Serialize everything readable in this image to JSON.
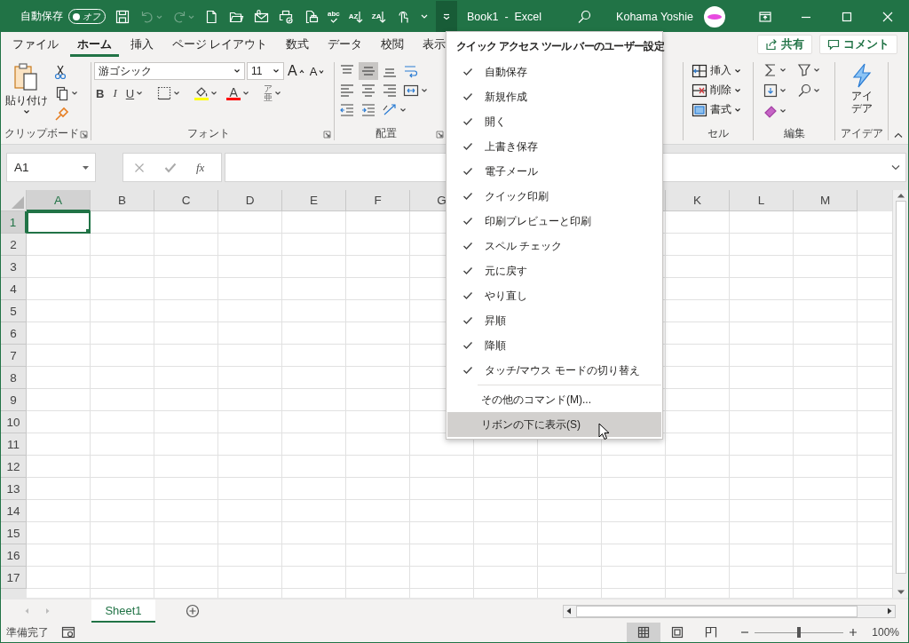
{
  "title_bar": {
    "autosave_label": "自動保存",
    "autosave_toggle": {
      "label": "オフ",
      "on": false
    },
    "qat": [
      {
        "kind": "save",
        "disabled": false
      },
      {
        "kind": "undo",
        "disabled": true
      },
      {
        "kind": "redo",
        "disabled": true
      },
      {
        "kind": "new",
        "disabled": false
      },
      {
        "kind": "open",
        "disabled": false
      },
      {
        "kind": "email",
        "disabled": false
      },
      {
        "kind": "quick_print",
        "disabled": false
      },
      {
        "kind": "print_preview",
        "disabled": false
      },
      {
        "kind": "spelling",
        "label": "abc",
        "disabled": false
      },
      {
        "kind": "sort_asc",
        "label": "AZ",
        "disabled": false
      },
      {
        "kind": "sort_desc",
        "label": "ZA",
        "disabled": false
      },
      {
        "kind": "touch",
        "disabled": false
      }
    ],
    "customize_selected": true,
    "title": "Book1  -  Excel",
    "user": "Kohama Yoshie"
  },
  "tabs": [
    {
      "label": "ファイル",
      "selected": false
    },
    {
      "label": "ホーム",
      "selected": true
    },
    {
      "label": "挿入",
      "selected": false
    },
    {
      "label": "ページ レイアウト",
      "selected": false
    },
    {
      "label": "数式",
      "selected": false
    },
    {
      "label": "データ",
      "selected": false
    },
    {
      "label": "校閲",
      "selected": false
    },
    {
      "label": "表示",
      "selected": false
    }
  ],
  "share": "共有",
  "comment": "コメント",
  "ribbon": {
    "clipboard": {
      "paste": "貼り付け",
      "label": "クリップボード"
    },
    "font": {
      "name": "游ゴシック",
      "size": "11",
      "grow": "A",
      "shrink": "A",
      "bold": "B",
      "italic": "I",
      "underline": "U",
      "font_color": "A",
      "phonetic": "ア亜",
      "label": "フォント"
    },
    "alignment": {
      "label": "配置",
      "buttons": [
        {
          "kind": "top",
          "selected": false
        },
        {
          "kind": "middle",
          "selected": true
        },
        {
          "kind": "bottom",
          "selected": false
        },
        {
          "kind": "wrap",
          "selected": false
        },
        {
          "kind": "left",
          "selected": false
        },
        {
          "kind": "center",
          "selected": false
        },
        {
          "kind": "right",
          "selected": false
        },
        {
          "kind": "merge",
          "selected": false
        },
        {
          "kind": "indent_dec",
          "selected": false
        },
        {
          "kind": "indent_inc",
          "selected": false
        },
        {
          "kind": "orientation",
          "selected": false
        }
      ]
    },
    "cells": {
      "items": [
        {
          "kind": "insert",
          "label": "挿入"
        },
        {
          "kind": "delete",
          "label": "削除"
        },
        {
          "kind": "format",
          "label": "書式"
        }
      ],
      "label": "セル"
    },
    "editing": {
      "label": "編集"
    },
    "ideas": {
      "button": "アイデア",
      "label": "アイデア"
    }
  },
  "formula_bar": {
    "name_box": "A1",
    "fx": "fx"
  },
  "sheet": {
    "columns": [
      {
        "label": "A",
        "selected": true
      },
      {
        "label": "B",
        "selected": false
      },
      {
        "label": "C",
        "selected": false
      },
      {
        "label": "D",
        "selected": false
      },
      {
        "label": "E",
        "selected": false
      },
      {
        "label": "F",
        "selected": false
      },
      {
        "label": "G",
        "selected": false
      },
      {},
      {},
      {},
      {
        "label": "K",
        "selected": false
      },
      {
        "label": "L",
        "selected": false
      },
      {
        "label": "M",
        "selected": false
      }
    ],
    "rows": [
      {
        "label": "1",
        "selected": true
      },
      {
        "label": "2",
        "selected": false
      },
      {
        "label": "3",
        "selected": false
      },
      {
        "label": "4",
        "selected": false
      },
      {
        "label": "5",
        "selected": false
      },
      {
        "label": "6",
        "selected": false
      },
      {
        "label": "7",
        "selected": false
      },
      {
        "label": "8",
        "selected": false
      },
      {
        "label": "9",
        "selected": false
      },
      {
        "label": "10",
        "selected": false
      },
      {
        "label": "11",
        "selected": false
      },
      {
        "label": "12",
        "selected": false
      },
      {
        "label": "13",
        "selected": false
      },
      {
        "label": "14",
        "selected": false
      },
      {
        "label": "15",
        "selected": false
      },
      {
        "label": "16",
        "selected": false
      },
      {
        "label": "17",
        "selected": false
      }
    ]
  },
  "sheet_tabs": [
    {
      "label": "Sheet1",
      "selected": true
    }
  ],
  "status_bar": {
    "text": "準備完了",
    "views": [
      {
        "kind": "normal",
        "selected": true
      },
      {
        "kind": "page_layout",
        "selected": false
      },
      {
        "kind": "page_break",
        "selected": false
      }
    ],
    "zoom": {
      "level": 0.5,
      "reading": "100%"
    }
  },
  "menu": {
    "title": "クイック アクセス ツール バーのユーザー設定",
    "items": [
      {
        "kind": "check",
        "label": "自動保存",
        "checked": true,
        "selected": false
      },
      {
        "kind": "check",
        "label": "新規作成",
        "checked": true,
        "selected": false
      },
      {
        "kind": "check",
        "label": "開く",
        "checked": true,
        "selected": false
      },
      {
        "kind": "check",
        "label": "上書き保存",
        "checked": true,
        "selected": false
      },
      {
        "kind": "check",
        "label": "電子メール",
        "checked": true,
        "selected": false
      },
      {
        "kind": "check",
        "label": "クイック印刷",
        "checked": true,
        "selected": false
      },
      {
        "kind": "check",
        "label": "印刷プレビューと印刷",
        "checked": true,
        "selected": false
      },
      {
        "kind": "check",
        "label": "スペル チェック",
        "checked": true,
        "selected": false
      },
      {
        "kind": "check",
        "label": "元に戻す",
        "checked": true,
        "selected": false
      },
      {
        "kind": "check",
        "label": "やり直し",
        "checked": true,
        "selected": false
      },
      {
        "kind": "check",
        "label": "昇順",
        "checked": true,
        "selected": false
      },
      {
        "kind": "check",
        "label": "降順",
        "checked": true,
        "selected": false
      },
      {
        "kind": "check",
        "label": "タッチ/マウス モードの切り替え",
        "checked": true,
        "selected": false
      },
      {
        "kind": "command",
        "label": "その他のコマンド(M)...",
        "selected": false
      },
      {
        "kind": "command",
        "label": "リボンの下に表示(S)",
        "selected": true
      }
    ]
  }
}
